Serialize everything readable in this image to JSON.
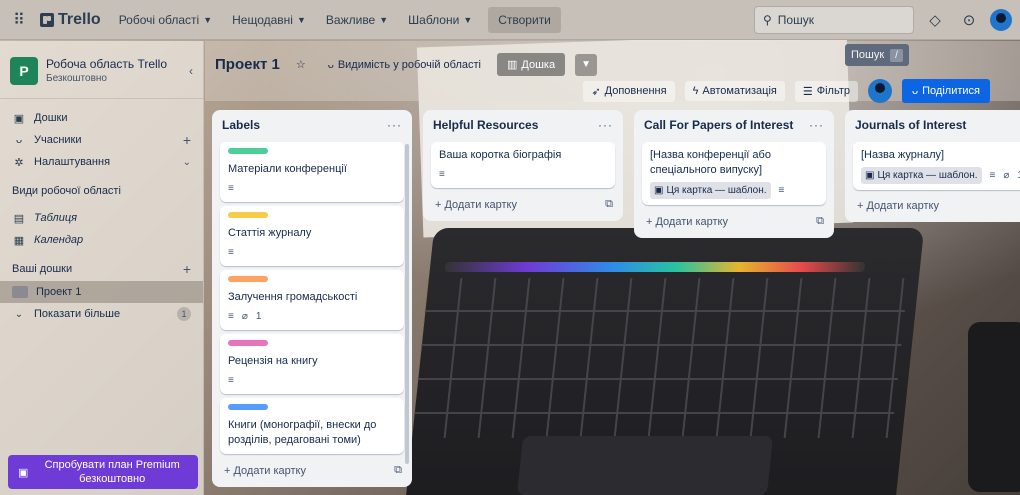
{
  "topbar": {
    "brand": "Trello",
    "nav": [
      {
        "label": "Робочі області"
      },
      {
        "label": "Нещодавні"
      },
      {
        "label": "Важливе"
      },
      {
        "label": "Шаблони"
      }
    ],
    "create_label": "Створити",
    "search_placeholder": "Пошук"
  },
  "tooltip": {
    "text": "Пошук",
    "shortcut": "/"
  },
  "sidebar": {
    "workspace_initial": "P",
    "workspace_name": "Робоча область Trello",
    "workspace_plan": "Безкоштовно",
    "items": [
      {
        "label": "Дошки"
      },
      {
        "label": "Учасники"
      },
      {
        "label": "Налаштування"
      }
    ],
    "views_title": "Види робочої області",
    "views": [
      {
        "label": "Таблиця"
      },
      {
        "label": "Календар"
      }
    ],
    "boards_title": "Ваші дошки",
    "boards": [
      {
        "label": "Проект 1"
      }
    ],
    "show_more": "Показати більше",
    "show_more_count": "1",
    "premium": "Спробувати план Premium безкоштовно"
  },
  "board": {
    "name": "Проект 1",
    "visibility": "Видимість у робочій області",
    "view": "Дошка",
    "powerups": "Доповнення",
    "automation": "Автоматизація",
    "filter": "Фільтр",
    "share": "Поділитися"
  },
  "lists": [
    {
      "title": "Labels",
      "menu": "···",
      "cards": [
        {
          "label_color": "#4bce97",
          "text": "Матеріали конференції",
          "desc": "≡",
          "attach": ""
        },
        {
          "label_color": "#f5cd47",
          "text": "Статтія журналу",
          "desc": "≡",
          "attach": ""
        },
        {
          "label_color": "#fea362",
          "text": "Залучення громадськості",
          "desc": "≡",
          "attach": "1"
        },
        {
          "label_color": "#e774bb",
          "text": "Рецензія на книгу",
          "desc": "≡",
          "attach": ""
        },
        {
          "label_color": "#579dff",
          "text": "Книги (монографії, внески до розділів, редаговані томи)",
          "desc": "",
          "attach": ""
        }
      ],
      "add_label": "+ Додати картку"
    },
    {
      "title": "Helpful Resources",
      "menu": "···",
      "cards": [
        {
          "text": "Ваша коротка біографія",
          "desc": "≡"
        }
      ],
      "add_label": "+ Додати картку"
    },
    {
      "title": "Call For Papers of Interest",
      "menu": "···",
      "cards": [
        {
          "text": "[Назва конференції або спеціального випуску]",
          "template": "Ця картка — шаблон.",
          "desc": "≡"
        }
      ],
      "add_label": "+ Додати картку"
    },
    {
      "title": "Journals of Interest",
      "menu": "···",
      "cards": [
        {
          "text": "[Назва журналу]",
          "template": "Ця картка — шаблон.",
          "desc": "≡",
          "attach": "1"
        }
      ],
      "add_label": "+ Додати картку"
    }
  ]
}
